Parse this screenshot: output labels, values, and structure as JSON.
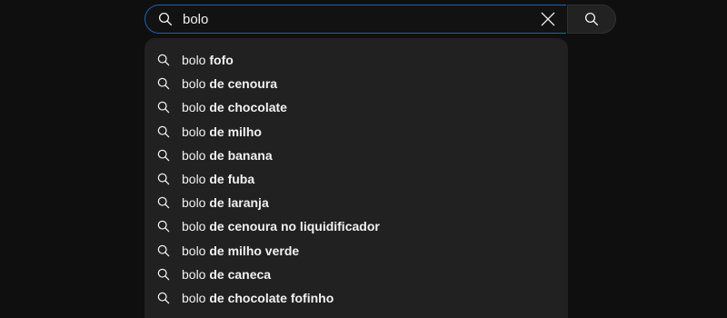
{
  "search": {
    "value": "bolo",
    "placeholder": ""
  },
  "suggestions": [
    {
      "query": "bolo",
      "completion": "fofo"
    },
    {
      "query": "bolo",
      "completion": "de cenoura"
    },
    {
      "query": "bolo",
      "completion": "de chocolate"
    },
    {
      "query": "bolo",
      "completion": "de milho"
    },
    {
      "query": "bolo",
      "completion": "de banana"
    },
    {
      "query": "bolo",
      "completion": "de fuba"
    },
    {
      "query": "bolo",
      "completion": "de laranja"
    },
    {
      "query": "bolo",
      "completion": "de cenoura no liquidificador"
    },
    {
      "query": "bolo",
      "completion": "de milho verde"
    },
    {
      "query": "bolo",
      "completion": "de caneca"
    },
    {
      "query": "bolo",
      "completion": "de chocolate fofinho"
    }
  ],
  "icons": {
    "lead": "search-icon",
    "clear": "close-icon",
    "submit": "search-icon",
    "suggestion": "search-icon"
  },
  "colors": {
    "background": "#0f0f0f",
    "focus_border": "#1c62b9",
    "dropdown": "#212121",
    "text": "#f1f1f1"
  }
}
